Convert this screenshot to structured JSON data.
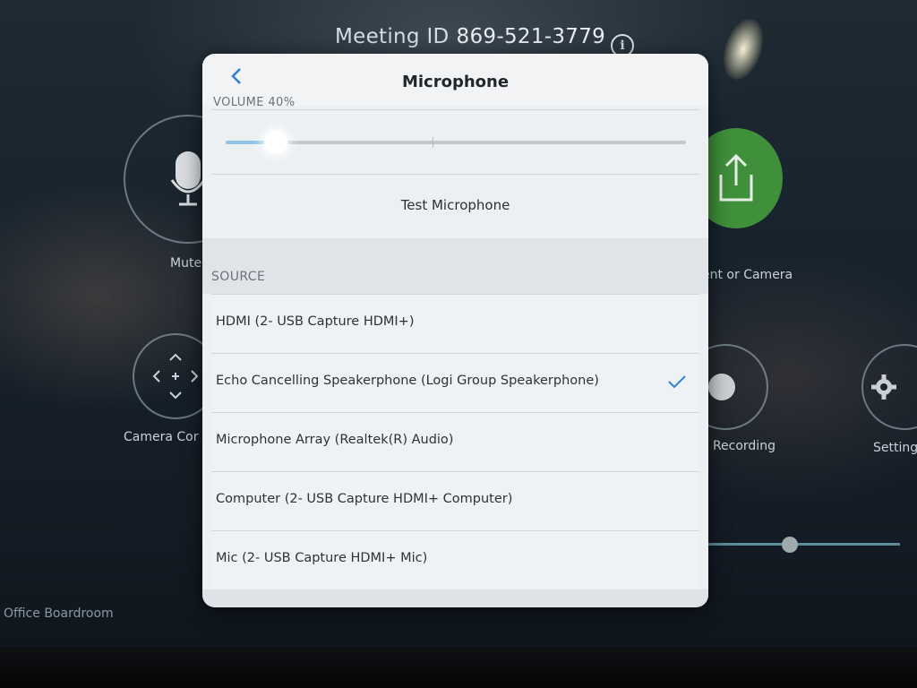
{
  "background": {
    "meeting_id_label": "Meeting ID",
    "meeting_id_value": "869-521-3779",
    "info_icon": "info-icon",
    "buttons": {
      "mute_label": "Mute",
      "camera_control_label": "Camera Cor",
      "share_label": "ent or Camera",
      "recording_label": "t Recording",
      "settings_label": "Setting"
    },
    "room_name": "Office Boardroom",
    "share_color": "#3f8f3b"
  },
  "dialog": {
    "title": "Microphone",
    "back_icon": "chevron-left-icon",
    "volume_label": "VOLUME 40%",
    "volume_level_percent": 40,
    "test_button_label": "Test Microphone",
    "source_section_label": "SOURCE",
    "sources": [
      {
        "label": "HDMI (2- USB Capture HDMI+)",
        "selected": false
      },
      {
        "label": "Echo Cancelling Speakerphone (Logi Group Speakerphone)",
        "selected": true
      },
      {
        "label": "Microphone Array (Realtek(R) Audio)",
        "selected": false
      },
      {
        "label": "Computer (2- USB Capture HDMI+ Computer)",
        "selected": false
      },
      {
        "label": "Mic (2- USB Capture HDMI+ Mic)",
        "selected": false
      }
    ],
    "accent_color": "#2f7fd4",
    "check_icon": "checkmark-icon"
  }
}
